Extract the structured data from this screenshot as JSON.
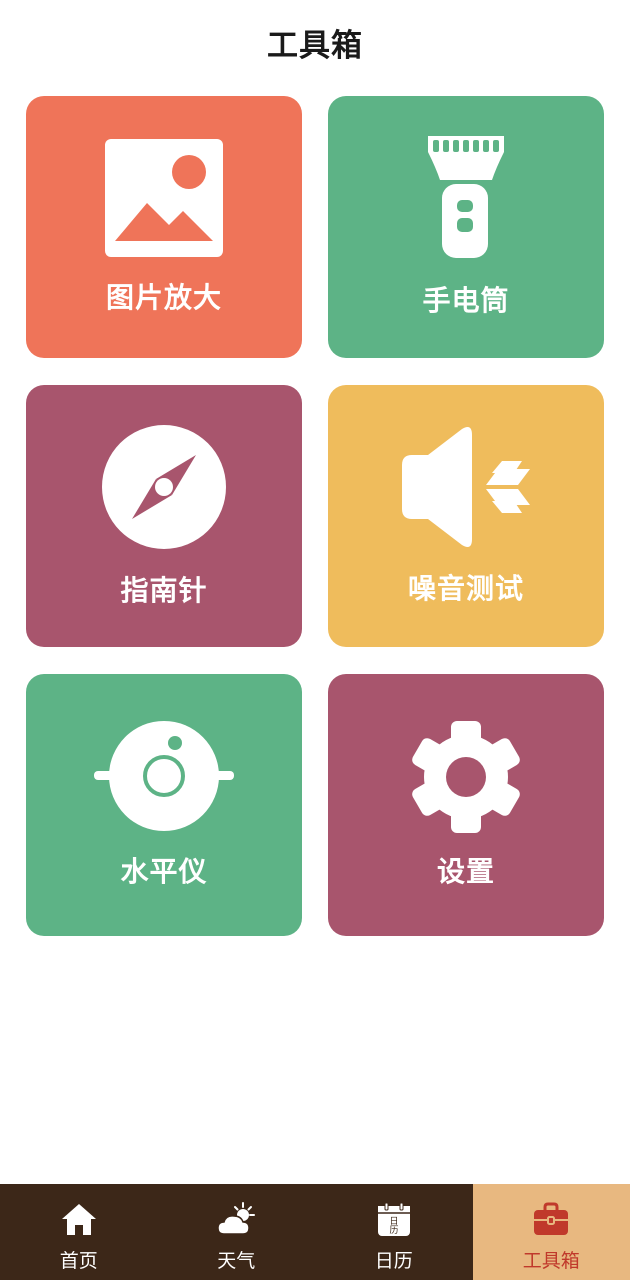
{
  "header": {
    "title": "工具箱"
  },
  "colors": {
    "coral": "#ef7459",
    "green": "#5db386",
    "plum": "#a8556d",
    "yellow": "#efbc5c",
    "tabbar_bg": "#3c2718",
    "tab_active_bg": "#e8b880",
    "tab_active_text": "#c0392b"
  },
  "tools": [
    {
      "label": "图片放大",
      "icon": "image-icon"
    },
    {
      "label": "手电筒",
      "icon": "flashlight-icon"
    },
    {
      "label": "指南针",
      "icon": "compass-icon"
    },
    {
      "label": "噪音测试",
      "icon": "speaker-icon"
    },
    {
      "label": "水平仪",
      "icon": "level-icon"
    },
    {
      "label": "设置",
      "icon": "gear-icon"
    }
  ],
  "tabs": [
    {
      "label": "首页",
      "icon": "home-icon",
      "active": false
    },
    {
      "label": "天气",
      "icon": "weather-icon",
      "active": false
    },
    {
      "label": "日历",
      "icon": "calendar-icon",
      "icon_text": "日历",
      "active": false
    },
    {
      "label": "工具箱",
      "icon": "toolbox-icon",
      "active": true
    }
  ]
}
